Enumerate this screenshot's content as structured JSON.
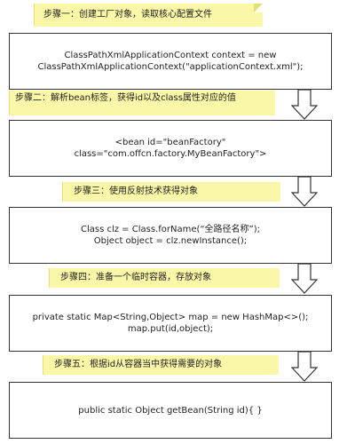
{
  "steps": [
    {
      "note": "步骤一：创建工厂对象，读取核心配置文件",
      "box_lines": [
        "ClassPathXmlApplicationContext context = new",
        "ClassPathXmlApplicationContext(\"applicationContext.xml\");"
      ]
    },
    {
      "note": "步骤二：解析bean标签，获得id以及class属性对应的值",
      "box_lines": [
        "<bean id=\"beanFactory\"",
        "class=\"com.offcn.factory.MyBeanFactory\">"
      ]
    },
    {
      "note": "步骤三：使用反射技术获得对象",
      "box_lines": [
        "Class clz = Class.forName(“全路径名称”);",
        "Object object = clz.newInstance();"
      ]
    },
    {
      "note": "步骤四：准备一个临时容器，存放对象",
      "box_lines": [
        "private static Map<String,Object> map = new HashMap<>();",
        "map.put(id,object);"
      ]
    },
    {
      "note": "步骤五：根据id从容器当中获得需要的对象",
      "box_lines": [
        "public  static Object getBean(String  id){   }"
      ]
    }
  ],
  "colors": {
    "note_bg": "#fbf7a9",
    "border": "#333333",
    "arrow_fill": "#ffffff"
  }
}
